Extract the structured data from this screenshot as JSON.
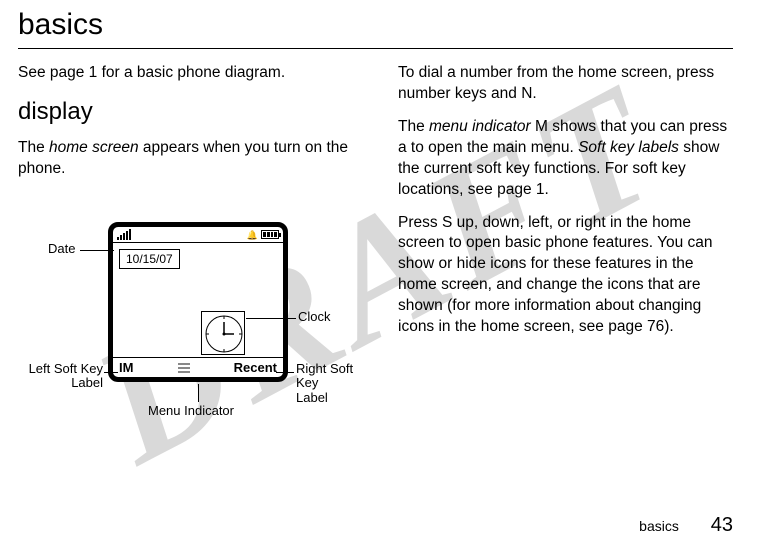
{
  "watermark": "DRAFT",
  "title": "basics",
  "left": {
    "p1": "See page 1 for a basic phone diagram.",
    "h2": "display",
    "p2_a": "The ",
    "p2_b": "home screen",
    "p2_c": " appears when you turn on the phone."
  },
  "phone": {
    "date_value": "10/15/07",
    "left_soft": "IM",
    "right_soft": "Recent"
  },
  "callouts": {
    "date": "Date",
    "clock": "Clock",
    "left_soft_1": "Left Soft Key",
    "left_soft_2": "Label",
    "right_soft_1": "Right Soft Key",
    "right_soft_2": "Label",
    "menu": "Menu Indicator"
  },
  "right": {
    "p1_a": "To dial a number from the home screen, press number keys and ",
    "p1_key": "N",
    "p1_b": ".",
    "p2_a": "The ",
    "p2_b": "menu indicator",
    "p2_c": " ",
    "p2_key1": "M",
    "p2_d": " shows that you can press ",
    "p2_key2": "a",
    "p2_e": " to open the main menu. ",
    "p2_f": "Soft key labels",
    "p2_g": " show the current soft key functions. For soft key locations, see page 1.",
    "p3_a": "Press ",
    "p3_key": "S",
    "p3_b": " up, down, left, or right in the home screen to open basic phone features. You can show or hide icons for these features in the home screen, and change the icons that are shown (for more information about changing icons in the home screen, see page 76)."
  },
  "footer": {
    "label": "basics",
    "page": "43"
  }
}
